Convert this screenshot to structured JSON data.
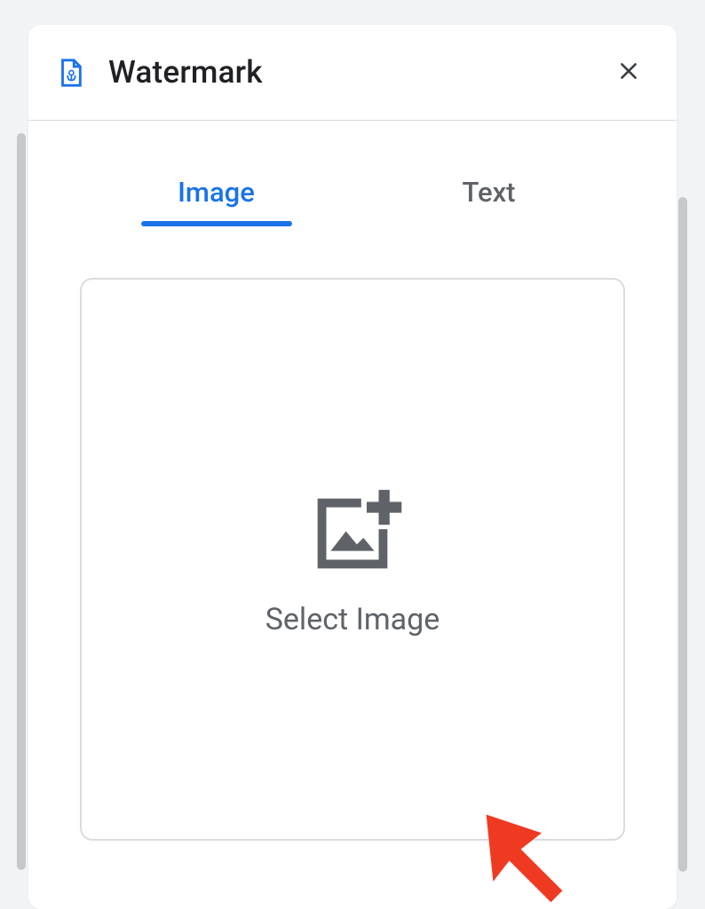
{
  "header": {
    "title": "Watermark"
  },
  "tabs": {
    "image": "Image",
    "text": "Text"
  },
  "dropzone": {
    "label": "Select Image"
  }
}
